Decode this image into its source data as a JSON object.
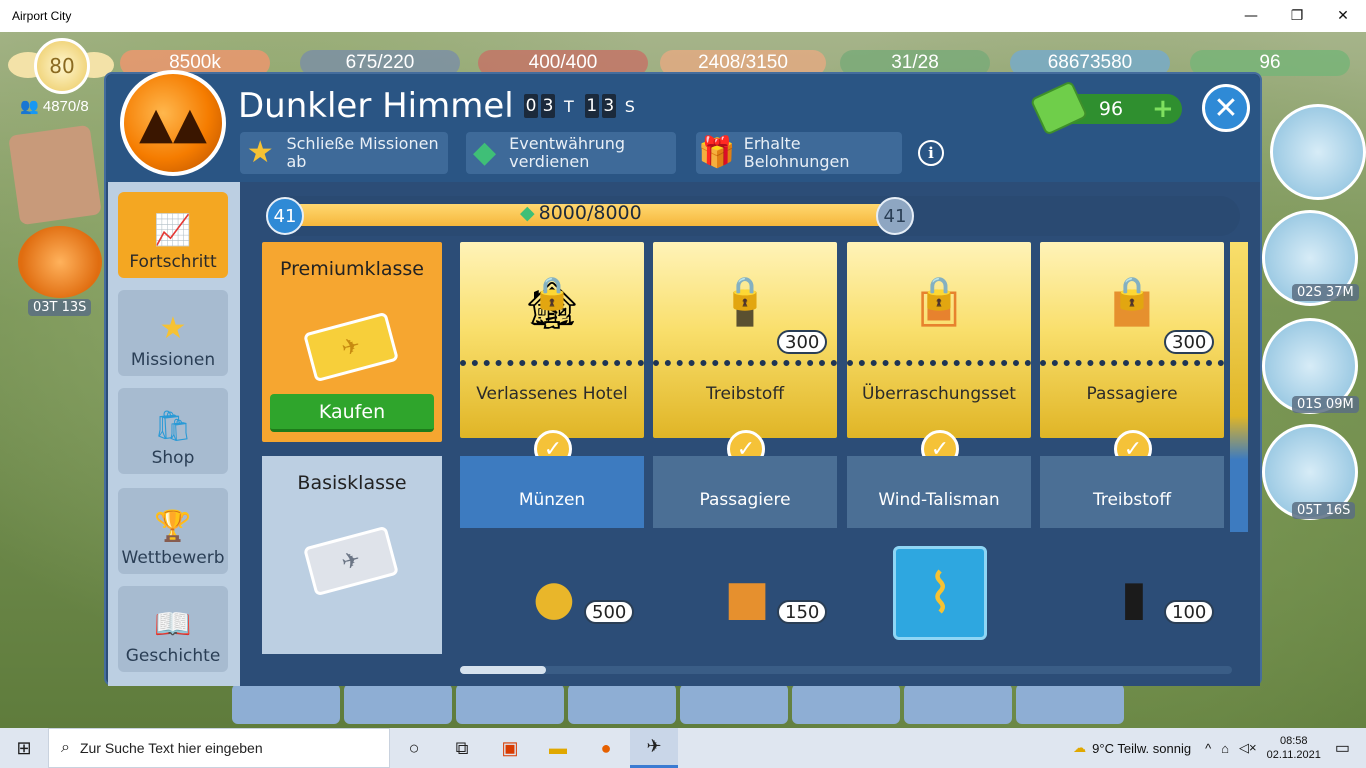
{
  "window": {
    "title": "Airport City",
    "minimize": "—",
    "maximize": "❐",
    "close": "✕"
  },
  "hud": {
    "level": "80",
    "coins": "8500k",
    "fuel": "675/220",
    "passengers": "400/400",
    "cargo": "2408/3150",
    "gems": "31/28",
    "money": "68673580",
    "cash": "96",
    "population": "4870/8",
    "left_timer": "03T 13S",
    "right_timers": [
      "02S 37M",
      "01S 09M",
      "05T 16S"
    ]
  },
  "dialog": {
    "title": "Dunkler Himmel",
    "timer": {
      "d1": "0",
      "d2": "3",
      "unit1": "T",
      "d3": "1",
      "d4": "3",
      "unit2": "S"
    },
    "steps": [
      {
        "label": "Schließe Missionen ab",
        "icon": "star-icon"
      },
      {
        "label": "Eventwährung verdienen",
        "icon": "gem-icon"
      },
      {
        "label": "Erhalte Belohnungen",
        "icon": "gift-icon"
      }
    ],
    "cash": "96",
    "cash_plus": "+",
    "close": "✕",
    "info": "i"
  },
  "nav": [
    {
      "label": "Fortschritt",
      "icon": "📈",
      "active": true
    },
    {
      "label": "Missionen",
      "icon": "★",
      "active": false
    },
    {
      "label": "Shop",
      "icon": "🛍",
      "active": false
    },
    {
      "label": "Wettbewerb",
      "icon": "🏆",
      "active": false
    },
    {
      "label": "Geschichte",
      "icon": "📖",
      "active": false
    }
  ],
  "progress": {
    "current_level": "41",
    "next_level": "41",
    "text": "8000/8000",
    "fraction": 1.0
  },
  "premium": {
    "label": "Premiumklasse",
    "buy": "Kaufen"
  },
  "basic": {
    "label": "Basisklasse"
  },
  "rewards": [
    {
      "premium_name": "Verlassenes Hotel",
      "premium_icon": "🏚",
      "premium_qty": "",
      "basic_name": "Münzen",
      "basic_icon": "🪙",
      "basic_qty": "500",
      "basic_active": true
    },
    {
      "premium_name": "Treibstoff",
      "premium_icon": "🛢",
      "premium_qty": "300",
      "basic_name": "Passagiere",
      "basic_icon": "🧳",
      "basic_qty": "150",
      "basic_active": false
    },
    {
      "premium_name": "Überraschungsset",
      "premium_icon": "🧰",
      "premium_qty": "",
      "basic_name": "Wind-Talisman",
      "basic_icon": "🎐",
      "basic_qty": "",
      "basic_active": false
    },
    {
      "premium_name": "Passagiere",
      "premium_icon": "🧳",
      "premium_qty": "300",
      "basic_name": "Treibstoff",
      "basic_icon": "🛢",
      "basic_qty": "100",
      "basic_active": false
    }
  ],
  "taskbar": {
    "search_placeholder": "Zur Suche Text hier eingeben",
    "weather": "9°C  Teilw. sonnig",
    "time": "08:58",
    "date": "02.11.2021"
  }
}
